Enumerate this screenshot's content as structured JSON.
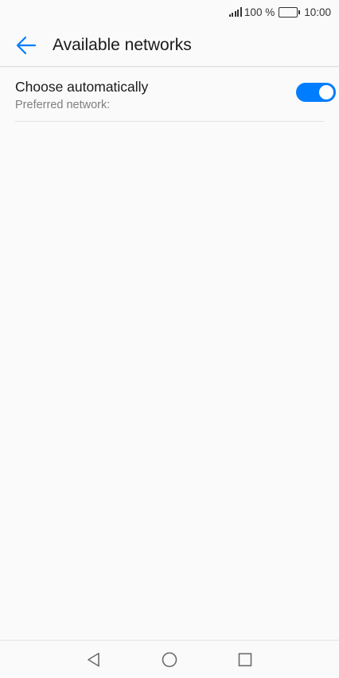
{
  "status_bar": {
    "battery_percent_text": "100 %",
    "time": "10:00",
    "battery_level": 1.0
  },
  "app_bar": {
    "title": "Available networks",
    "back_icon": "arrow-left-icon",
    "accent_color": "#007dff"
  },
  "settings": {
    "choose_automatically": {
      "label": "Choose automatically",
      "sublabel": "Preferred network:",
      "enabled": true
    }
  },
  "nav_bar": {
    "back_icon": "triangle-back-icon",
    "home_icon": "circle-home-icon",
    "recents_icon": "square-recents-icon"
  }
}
